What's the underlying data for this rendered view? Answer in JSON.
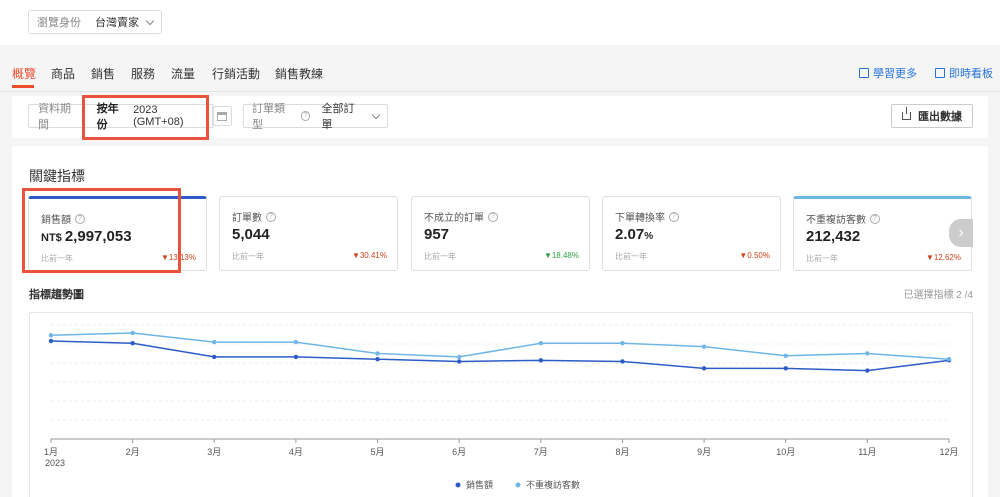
{
  "topbar": {
    "role_label": "瀏覽身份",
    "role_value": "台灣賣家"
  },
  "tabs": [
    {
      "label": "概覽",
      "active": true
    },
    {
      "label": "商品",
      "active": false
    },
    {
      "label": "銷售",
      "active": false
    },
    {
      "label": "服務",
      "active": false
    },
    {
      "label": "流量",
      "active": false
    },
    {
      "label": "行銷活動",
      "active": false
    },
    {
      "label": "銷售教練",
      "active": false
    }
  ],
  "links": {
    "learn_more": "學習更多",
    "dashboard": "即時看板"
  },
  "filters": {
    "period_label": "資料期間",
    "period_mode": "按年份",
    "period_value": "2023 (GMT+08)",
    "order_type_label": "訂單類型",
    "order_type_value": "全部訂單",
    "export_label": "匯出數據"
  },
  "key_metrics": {
    "title": "關鍵指標",
    "cards": [
      {
        "title": "銷售額",
        "prefix": "NT$ ",
        "value": "2,997,053",
        "unit": "",
        "compare": "比前一年",
        "change": "▼13.13%",
        "direction": "down"
      },
      {
        "title": "訂單數",
        "prefix": "",
        "value": "5,044",
        "unit": "",
        "compare": "比前一年",
        "change": "▼30.41%",
        "direction": "down"
      },
      {
        "title": "不成立的訂單",
        "prefix": "",
        "value": "957",
        "unit": "",
        "compare": "比前一年",
        "change": "▼18.48%",
        "direction": "up"
      },
      {
        "title": "下單轉換率",
        "prefix": "",
        "value": "2.07",
        "unit": "%",
        "compare": "比前一年",
        "change": "▼0.50%",
        "direction": "down"
      },
      {
        "title": "不重複訪客數",
        "prefix": "",
        "value": "212,432",
        "unit": "",
        "compare": "比前一年",
        "change": "▼12.62%",
        "direction": "down"
      }
    ]
  },
  "trend": {
    "title": "指標趨勢圖",
    "selected_count": "已選擇指標 2 /4"
  },
  "colors": {
    "accent": "#ee4d2d",
    "link": "#2673dd",
    "series_sales": "#2d5cc8",
    "series_visitors": "#6fb6e6",
    "highlight_frame": "#e8533e"
  },
  "chart_data": {
    "type": "line",
    "categories": [
      "1月",
      "2月",
      "3月",
      "4月",
      "5月",
      "6月",
      "7月",
      "8月",
      "9月",
      "10月",
      "11月",
      "12月"
    ],
    "x_sublabel": "2023",
    "y_axis_labels_shown": false,
    "grid": true,
    "legend_position": "bottom-center",
    "ylim": [
      0,
      100
    ],
    "series": [
      {
        "name": "銷售額",
        "color": "#2d5cc8",
        "values": [
          86,
          84,
          72,
          72,
          70,
          68,
          69,
          68,
          62,
          62,
          60,
          69
        ]
      },
      {
        "name": "不重複訪客數",
        "color": "#6fb6e6",
        "values": [
          91,
          93,
          85,
          85,
          75,
          72,
          84,
          84,
          81,
          73,
          75,
          70
        ]
      }
    ]
  }
}
